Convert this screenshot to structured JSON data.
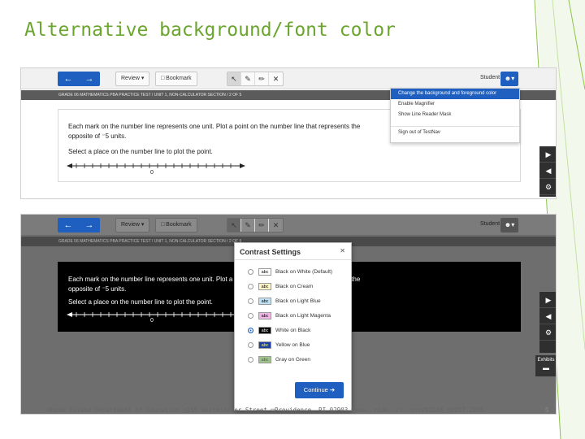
{
  "slide": {
    "title": "Alternative background/font color",
    "footer": "Rhode Island Department of Education □255 Westminster Street □Providence, RI 02903 □www. ride. ri. gov/RICAS □2017-2018",
    "page_number": "5",
    "accent_color": "#6aa52e"
  },
  "toolbar": {
    "back_icon": "←",
    "forward_icon": "→",
    "review_label": "Review ▾",
    "bookmark_label": "□ Bookmark",
    "tools": [
      "↖",
      "✎",
      "✏",
      "✕"
    ],
    "student_label": "Student",
    "avatar_label": "☻▾",
    "accent_color": "#1f5fbf"
  },
  "breadcrumb": "GRADE 06 MATHEMATICS PBA PRACTICE TEST   /   UNIT 1, NON-CALCULATOR SECTION   /   2 OF 5",
  "question": {
    "text": "Each mark on the number line represents one unit. Plot a point on the number line that represents the opposite of ⁻5 units.",
    "prompt": "Select a place on the number line to plot the point.",
    "zero_label": "0"
  },
  "account_menu": {
    "items": [
      "Change the background and foreground color",
      "Enable Magnifier",
      "Show Line Reader Mask",
      "Sign out of TestNav"
    ]
  },
  "side_tools": {
    "play_icon": "▶",
    "megaphone_icon": "◀",
    "gear_icon": "⚙",
    "exhibits_label": "Exhibits",
    "folder_icon": "▬"
  },
  "contrast_dialog": {
    "title": "Contrast Settings",
    "close_icon": "✕",
    "swatch_text": "abc",
    "options": [
      {
        "label": "Black on White (Default)",
        "fg": "#000000",
        "bg": "#ffffff",
        "selected": false
      },
      {
        "label": "Black on Cream",
        "fg": "#000000",
        "bg": "#fff5c8",
        "selected": false
      },
      {
        "label": "Black on Light Blue",
        "fg": "#000000",
        "bg": "#bfe2f5",
        "selected": false
      },
      {
        "label": "Black on Light Magenta",
        "fg": "#000000",
        "bg": "#f0b8e6",
        "selected": false
      },
      {
        "label": "White on Black",
        "fg": "#ffffff",
        "bg": "#000000",
        "selected": true
      },
      {
        "label": "Yellow on Blue",
        "fg": "#ffff33",
        "bg": "#1f3fa0",
        "selected": false
      },
      {
        "label": "Gray on Green",
        "fg": "#555555",
        "bg": "#9fc48a",
        "selected": false
      }
    ],
    "continue_label": "Continue ➔"
  }
}
